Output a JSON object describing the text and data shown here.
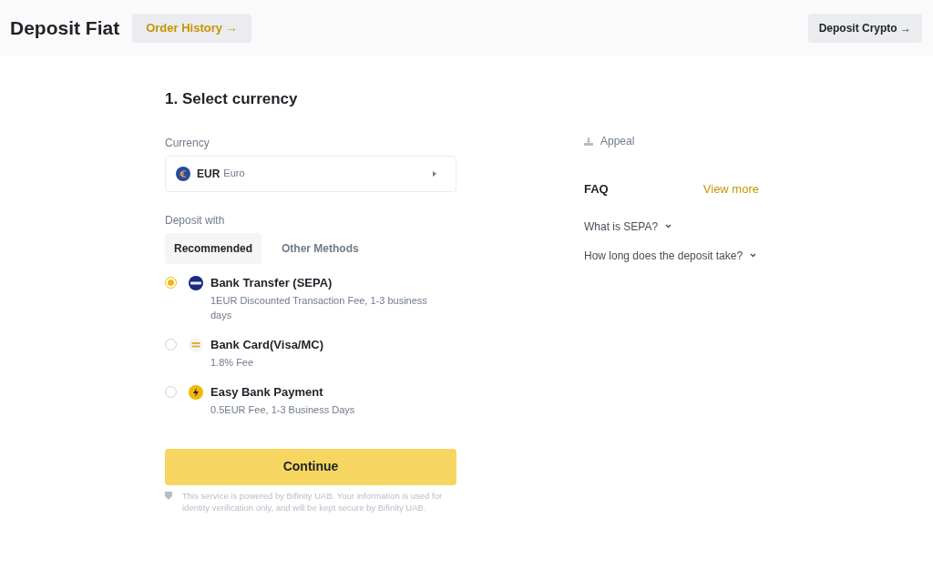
{
  "header": {
    "title": "Deposit Fiat",
    "order_history": "Order History →",
    "deposit_crypto": "Deposit Crypto →"
  },
  "step_title": "1. Select currency",
  "currency": {
    "label": "Currency",
    "code": "EUR",
    "name": "Euro"
  },
  "deposit_with": {
    "label": "Deposit with",
    "tabs": [
      {
        "label": "Recommended",
        "selected": true
      },
      {
        "label": "Other Methods",
        "selected": false
      }
    ]
  },
  "methods": [
    {
      "kind": "sepa",
      "title": "Bank Transfer (SEPA)",
      "detail": "1EUR Discounted Transaction Fee, 1-3 business days",
      "selected": true
    },
    {
      "kind": "card",
      "title": "Bank Card(Visa/MC)",
      "detail": "1.8% Fee",
      "selected": false
    },
    {
      "kind": "lightning",
      "title": "Easy Bank Payment",
      "detail": "0.5EUR Fee, 1-3 Business Days",
      "selected": false
    }
  ],
  "continue_button": "Continue",
  "disclaimer": "This service is powered by Bifinity UAB. Your information is used for identity verification only, and will be kept secure by Bifinity UAB.",
  "appeal": "Appeal",
  "faq": {
    "title": "FAQ",
    "view_more": "View more",
    "items": [
      "What is SEPA?",
      "How long does the deposit take?"
    ]
  }
}
